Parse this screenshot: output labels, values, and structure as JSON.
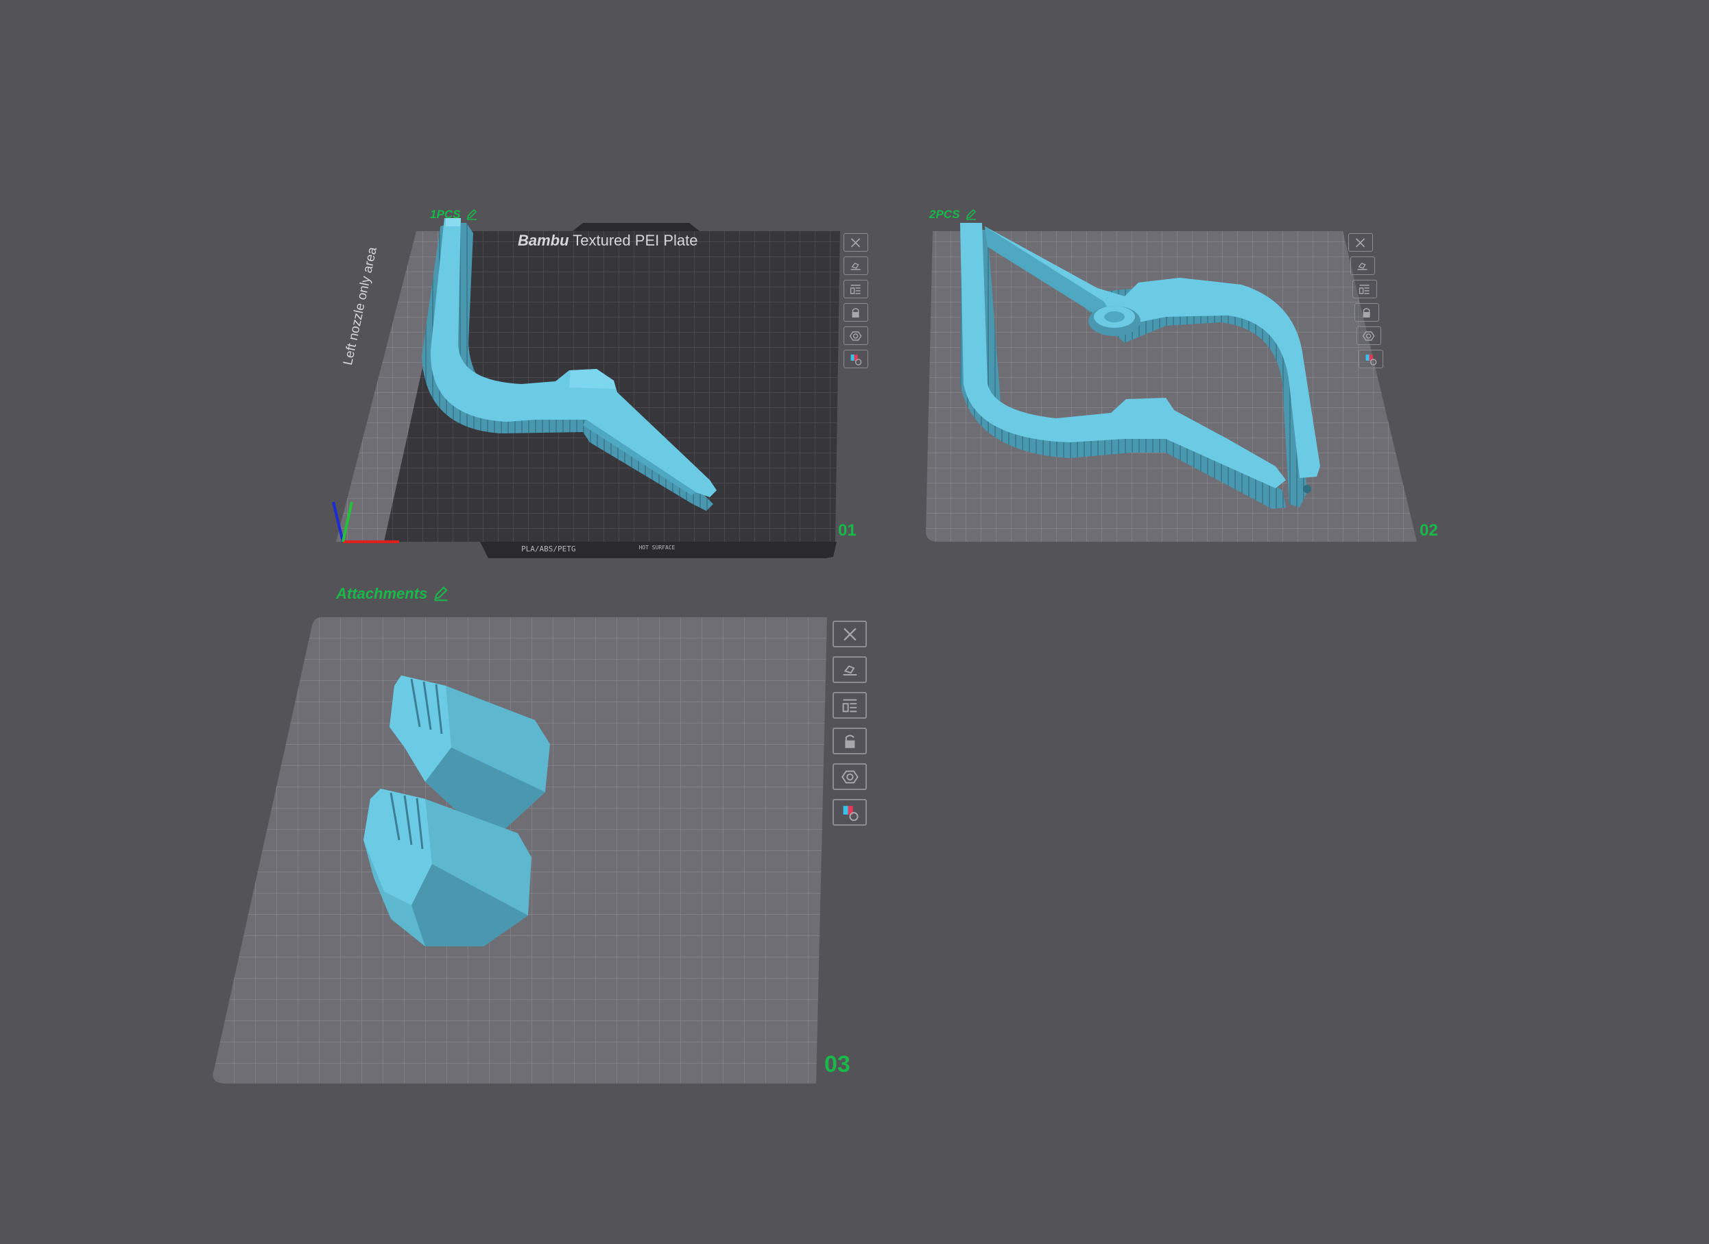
{
  "scene": {
    "background": "#545358",
    "model_color": "#6ccbe4",
    "label_color": "#19b84a"
  },
  "plates": [
    {
      "name": "1PCS",
      "number": "01",
      "bed_title_bold": "Bambu",
      "bed_title_rest": " Textured PEI Plate",
      "exclusion_label": "Left nozzle only area",
      "bed_footer_filaments": "PLA/ABS/PETG",
      "bed_footer_surface": "HOT SURFACE",
      "objects": [
        "Clamp half"
      ]
    },
    {
      "name": "2PCS",
      "number": "02",
      "objects": [
        "Clamp pair"
      ]
    },
    {
      "name": "Attachments",
      "number": "03",
      "objects": [
        "Attachment A",
        "Attachment B"
      ]
    }
  ],
  "plate_tools": [
    {
      "name": "remove-plate",
      "icon": "close-icon"
    },
    {
      "name": "auto-orient",
      "icon": "orient-icon"
    },
    {
      "name": "arrange",
      "icon": "arrange-icon"
    },
    {
      "name": "lock-plate",
      "icon": "lock-icon"
    },
    {
      "name": "plate-settings",
      "icon": "settings-icon"
    },
    {
      "name": "plate-filament-preview",
      "icon": "filament-preview-icon"
    }
  ]
}
